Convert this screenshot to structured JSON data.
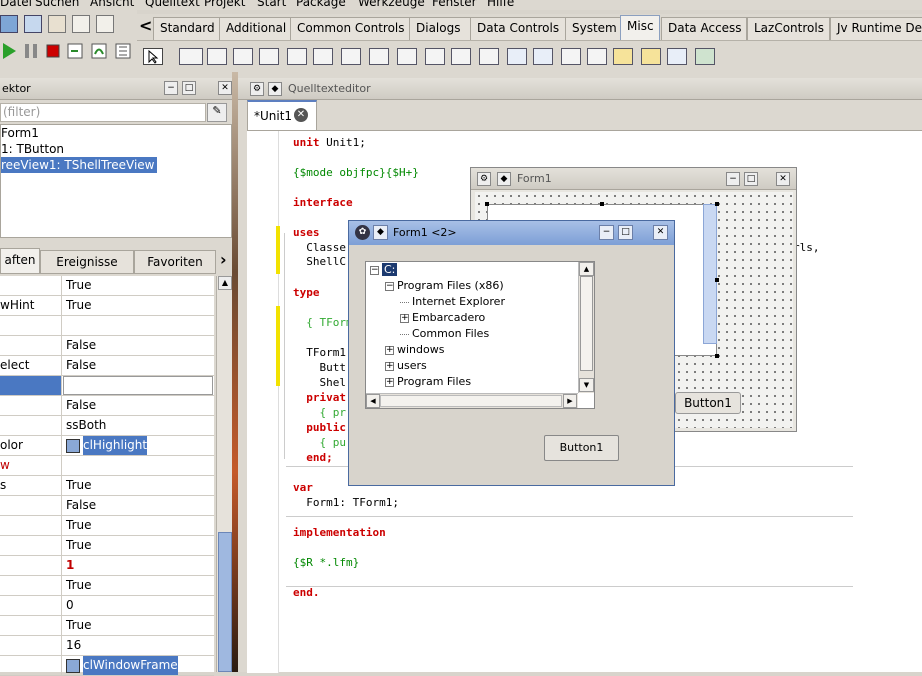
{
  "menubar": {
    "items": [
      "Datei",
      "Suchen",
      "Ansicht",
      "Quelltext",
      "Projekt",
      "Start",
      "Package",
      "Werkzeuge",
      "Fenster",
      "Hilfe"
    ]
  },
  "palette": {
    "scroll_left": "<",
    "tabs": [
      "Standard",
      "Additional",
      "Common Controls",
      "Dialogs",
      "Data Controls",
      "System",
      "Misc",
      "Data Access",
      "LazControls",
      "Jv Runtime Design"
    ],
    "active_tab": "Misc"
  },
  "inspector": {
    "title": "ektor",
    "filter_placeholder": "(filter)",
    "tree": [
      "Form1",
      "1: TButton",
      "reeView1: TShellTreeView"
    ],
    "tabs": [
      "aften",
      "Ereignisse",
      "Favoriten"
    ],
    "rows": [
      {
        "name": "",
        "value": "True"
      },
      {
        "name": "wHint",
        "value": "True"
      },
      {
        "name": "",
        "value": ""
      },
      {
        "name": "",
        "value": "False"
      },
      {
        "name": "elect",
        "value": "False"
      },
      {
        "name": "",
        "value": ""
      },
      {
        "name": "",
        "value": "False"
      },
      {
        "name": "",
        "value": "ssBoth"
      },
      {
        "name": "olor",
        "value": "clHighlight"
      },
      {
        "name": "w",
        "value": ""
      },
      {
        "name": "s",
        "value": "True"
      },
      {
        "name": "",
        "value": "False"
      },
      {
        "name": "",
        "value": "True"
      },
      {
        "name": "",
        "value": "True"
      },
      {
        "name": "",
        "value": "1"
      },
      {
        "name": "",
        "value": "True"
      },
      {
        "name": "",
        "value": "0"
      },
      {
        "name": "",
        "value": "True"
      },
      {
        "name": "",
        "value": "16"
      },
      {
        "name": "",
        "value": "clWindowFrame"
      }
    ],
    "colors": {
      "highlight": "#4a78c2",
      "red": "#c00000"
    }
  },
  "editor": {
    "title": "Quelltexteditor",
    "tab": "*Unit1",
    "code": {
      "unit_kw": "unit",
      "unit_rest": " Unit1;",
      "mode": "{$mode objfpc}{$H+}",
      "interface": "interface",
      "uses": "uses",
      "classes": "  Classe",
      "classes_tail": "rls,",
      "shellc": "  ShellC",
      "type": "type",
      "tform_comment": "  { TForm",
      "tform": "  TForm1",
      "butt": "    Butt",
      "shel": "    Shel",
      "private": "  privat",
      "pr": "    { pr",
      "public": "  public",
      "pu": "    { pu",
      "end": "  end;",
      "var": "var",
      "form1var": "  Form1: TForm1;",
      "implementation": "implementation",
      "lfm": "{$R *.lfm}",
      "endfinal": "end."
    }
  },
  "designer": {
    "title": "Form1",
    "button": "Button1"
  },
  "form2": {
    "title": "Form1 <2>",
    "tree": [
      {
        "label": "C:",
        "indent": 0,
        "toggle": "−"
      },
      {
        "label": "Program Files (x86)",
        "indent": 1,
        "toggle": "−"
      },
      {
        "label": "Internet Explorer",
        "indent": 2,
        "toggle": ""
      },
      {
        "label": "Embarcadero",
        "indent": 2,
        "toggle": "+"
      },
      {
        "label": "Common Files",
        "indent": 2,
        "toggle": ""
      },
      {
        "label": "windows",
        "indent": 1,
        "toggle": "+"
      },
      {
        "label": "users",
        "indent": 1,
        "toggle": "+"
      },
      {
        "label": "Program Files",
        "indent": 1,
        "toggle": "+"
      }
    ],
    "button": "Button1"
  }
}
